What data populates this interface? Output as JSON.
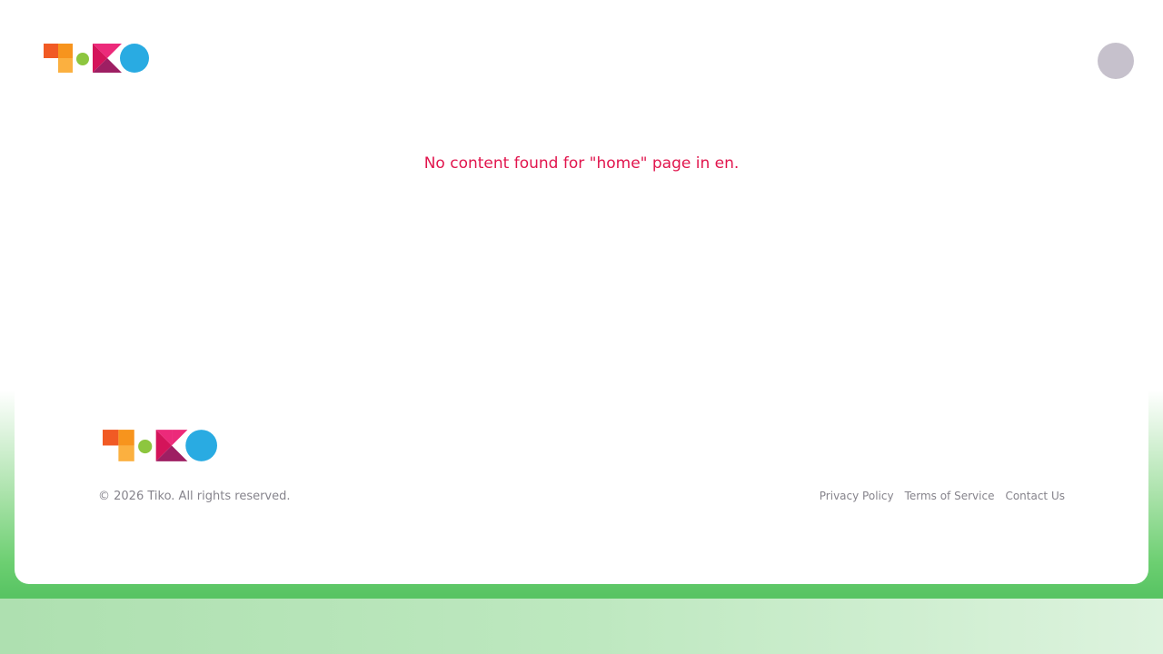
{
  "header": {
    "logo": "tiko-logo",
    "avatar": "user-avatar"
  },
  "main": {
    "message": "No content found for \"home\" page in en."
  },
  "footer": {
    "logo": "tiko-logo",
    "copyright": "© 2026 Tiko. All rights reserved.",
    "links": [
      {
        "label": "Privacy Policy"
      },
      {
        "label": "Terms of Service"
      },
      {
        "label": "Contact Us"
      }
    ]
  },
  "colors": {
    "message": "#e1154d",
    "avatar": "#c6c1cc",
    "footer_text": "#86848c",
    "green": "#58c463"
  }
}
